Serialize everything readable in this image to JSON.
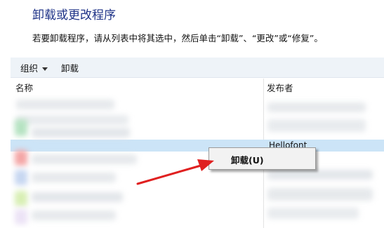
{
  "page": {
    "title": "卸载或更改程序",
    "instructions": "若要卸载程序，请从列表中将其选中，然后单击“卸载”、“更改”或“修复”。"
  },
  "toolbar": {
    "organize_label": "组织",
    "uninstall_label": "卸载"
  },
  "columns": {
    "name": "名称",
    "publisher": "发布者"
  },
  "selected_row": {
    "publisher": "Hellofont"
  },
  "context_menu": {
    "uninstall_label": "卸载(U)"
  },
  "colors": {
    "title": "#1e3287",
    "toolbar_bg": "#eef3f8",
    "selection": "#cce4f7",
    "arrow": "#e02020"
  }
}
